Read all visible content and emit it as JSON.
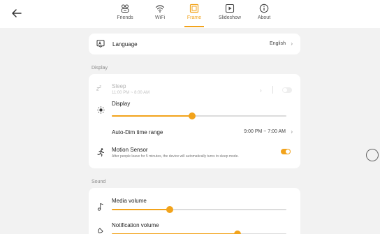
{
  "tabs": [
    {
      "label": "Friends",
      "icon": "friends-icon"
    },
    {
      "label": "WiFi",
      "icon": "wifi-icon"
    },
    {
      "label": "Frame",
      "icon": "frame-icon",
      "active": true
    },
    {
      "label": "Slideshow",
      "icon": "slideshow-icon"
    },
    {
      "label": "About",
      "icon": "about-icon"
    }
  ],
  "language": {
    "label": "Language",
    "value": "English"
  },
  "display_section": {
    "header": "Display",
    "sleep": {
      "label": "Sleep",
      "time": "11:00 PM ~ 8:00 AM",
      "enabled": false
    },
    "display": {
      "label": "Display",
      "level": 0.46
    },
    "auto_dim": {
      "label": "Auto-Dim time range",
      "value": "9:00 PM ~ 7:00 AM"
    },
    "motion": {
      "label": "Motion Sensor",
      "description": "After people leave for 5 minutes, the device will automatically turns to sleep mode.",
      "enabled": true
    }
  },
  "sound_section": {
    "header": "Sound",
    "media": {
      "label": "Media volume",
      "level": 0.33
    },
    "notification": {
      "label": "Notification volume",
      "level": 0.72
    }
  },
  "colors": {
    "accent": "#f2a31b",
    "background": "#f2f2f2",
    "card": "#ffffff"
  }
}
